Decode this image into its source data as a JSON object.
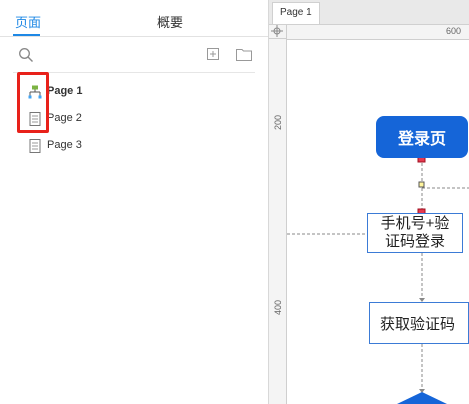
{
  "left_panel": {
    "tabs": [
      {
        "label": "页面",
        "active": true
      },
      {
        "label": "概要",
        "active": false
      }
    ],
    "toolbar": {
      "search_icon": "search-icon",
      "add_page_icon": "add-page-icon",
      "add_folder_icon": "add-folder-icon"
    },
    "pages": [
      {
        "label": "Page 1",
        "icon": "sitemap-icon",
        "bold": true
      },
      {
        "label": "Page 2",
        "icon": "page-icon",
        "bold": false
      },
      {
        "label": "Page 3",
        "icon": "page-icon",
        "bold": false
      }
    ],
    "highlight_color": "#e8211a"
  },
  "canvas": {
    "open_tab": "Page 1",
    "ruler": {
      "horizontal_label": "600",
      "vertical_labels": [
        "200",
        "400"
      ]
    },
    "nodes": {
      "login": "登录页",
      "phone_line1": "手机号+验",
      "phone_line2": "证码登录",
      "get_code": "获取验证码"
    },
    "accent_color": "#1565d8"
  }
}
